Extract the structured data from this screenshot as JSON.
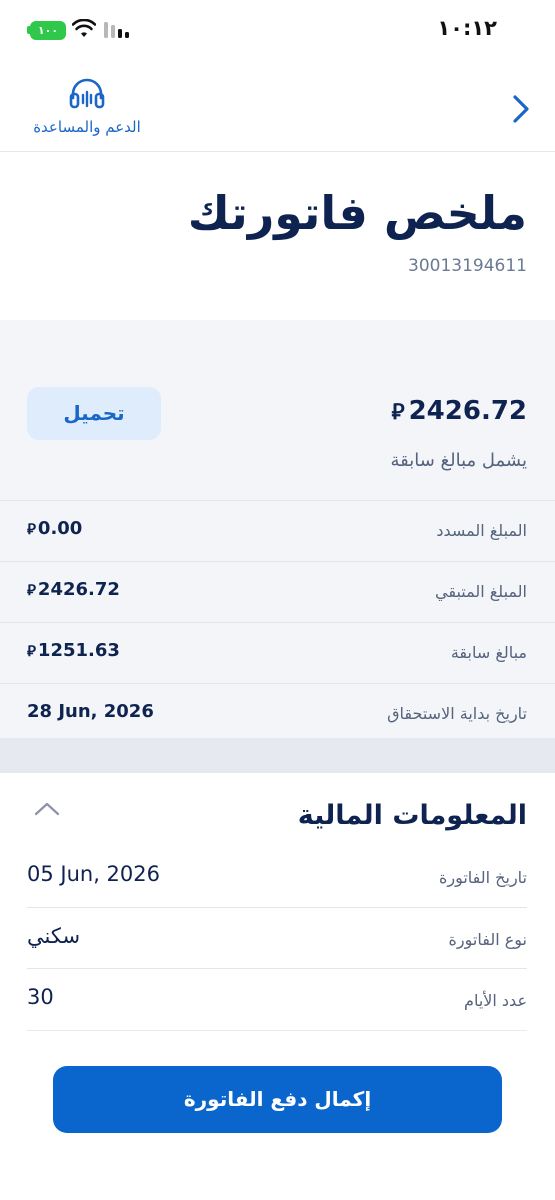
{
  "status_bar": {
    "time": "١٠:١٢",
    "battery": "١٠٠"
  },
  "header": {
    "support_label": "الدعم والمساعدة"
  },
  "title": "ملخص فاتورتك",
  "account_number": "30013194611",
  "summary": {
    "amount": "2426.72",
    "currency": "⃁",
    "includes_text": "يشمل مبالغ سابقة",
    "download_label": "تحميل",
    "rows": [
      {
        "label": "المبلغ المسدد",
        "value": "0.00"
      },
      {
        "label": "المبلغ المتبقي",
        "value": "2426.72"
      },
      {
        "label": "مبالغ سابقة",
        "value": "1251.63"
      },
      {
        "label": "تاريخ بداية الاستحقاق",
        "value": "28 Jun, 2026"
      }
    ]
  },
  "financial": {
    "title": "المعلومات المالية",
    "rows": [
      {
        "label": "تاريخ الفاتورة",
        "value": "05 Jun, 2026"
      },
      {
        "label": "نوع الفاتورة",
        "value": "سكني"
      },
      {
        "label": "عدد الأيام",
        "value": "30"
      }
    ]
  },
  "cta_label": "إكمال دفع الفاتورة",
  "colors": {
    "accent": "#0a66cc",
    "navy": "#0e2350",
    "gray_bg": "#f3f5f9",
    "battery": "#2fc84a"
  }
}
